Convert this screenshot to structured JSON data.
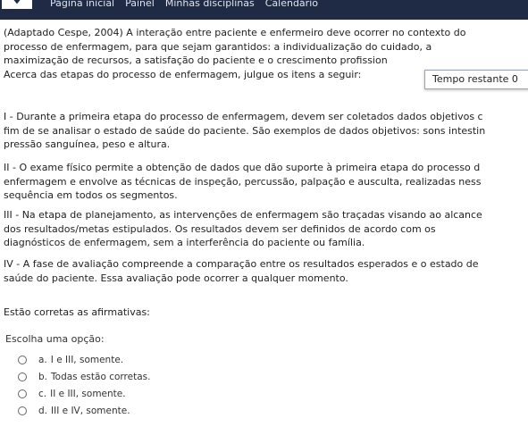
{
  "nav": {
    "items": [
      "Página inicial",
      "Painel",
      "Minhas disciplinas",
      "Calendário"
    ]
  },
  "question": {
    "intro_lines": [
      "(Adaptado Cespe, 2004) A interação entre paciente e enfermeiro deve ocorrer no contexto do",
      "processo de enfermagem, para que sejam garantidos: a individualização do cuidado, a",
      "maximização de recursos, a satisfação do paciente e o crescimento profission",
      "Acerca das etapas do processo de enfermagem, julgue os itens a seguir:"
    ],
    "statements": [
      {
        "lines": [
          "I - Durante a primeira etapa do processo de enfermagem, devem ser coletados dados objetivos c",
          "fim de se analisar o estado de saúde do paciente. São exemplos de dados objetivos: sons intestin",
          "pressão sanguínea, peso e altura."
        ]
      },
      {
        "lines": [
          "II - O exame físico permite a obtenção de dados que dão suporte à primeira etapa do processo d",
          "enfermagem e envolve as técnicas de inspeção, percussão, palpação e ausculta, realizadas ness",
          "sequência em todos os segmentos."
        ]
      },
      {
        "lines": [
          "III - Na etapa de planejamento, as intervenções de enfermagem são traçadas visando ao alcance",
          "dos resultados/metas estipulados. Os resultados devem ser definidos de acordo com os",
          "diagnósticos de enfermagem, sem a interferência do paciente ou família."
        ]
      },
      {
        "lines": [
          "IV - A fase de avaliação compreende a comparação entre os resultados esperados e o estado de",
          "saúde do paciente. Essa avaliação pode ocorrer a qualquer momento."
        ]
      }
    ],
    "prompt": "Estão corretas as afirmativas:",
    "choose_label": "Escolha uma opção:",
    "options": [
      {
        "letter": "a.",
        "text": "I e III, somente."
      },
      {
        "letter": "b.",
        "text": "Todas estão corretas."
      },
      {
        "letter": "c.",
        "text": "II e III, somente."
      },
      {
        "letter": "d.",
        "text": "III e IV, somente."
      }
    ]
  },
  "timer": {
    "label": "Tempo restante 0"
  },
  "colors": {
    "topbar": "#1f2a44",
    "text": "#222222"
  }
}
